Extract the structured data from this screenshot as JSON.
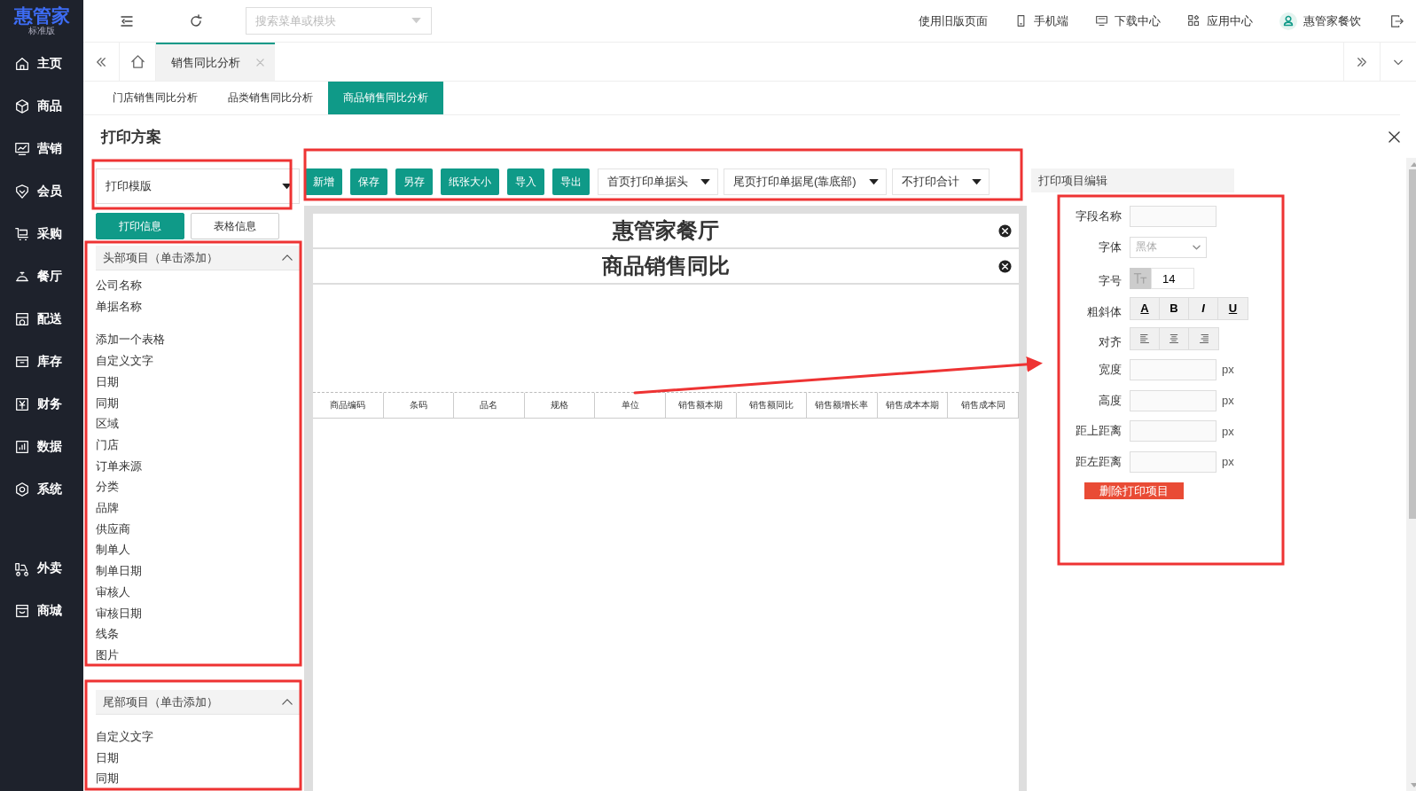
{
  "logo": {
    "title": "惠管家",
    "subtitle": "标准版"
  },
  "sidebar": {
    "groups": [
      [
        {
          "label": "主页",
          "kind": "home"
        },
        {
          "label": "商品",
          "kind": "box"
        },
        {
          "label": "营销",
          "kind": "chart"
        },
        {
          "label": "会员",
          "kind": "shield"
        },
        {
          "label": "采购",
          "kind": "cart"
        },
        {
          "label": "餐厅",
          "kind": "bell"
        },
        {
          "label": "配送",
          "kind": "delivery"
        },
        {
          "label": "库存",
          "kind": "tray"
        },
        {
          "label": "财务",
          "kind": "yen"
        },
        {
          "label": "数据",
          "kind": "bars"
        },
        {
          "label": "系统",
          "kind": "gear"
        }
      ],
      [
        {
          "label": "外卖",
          "kind": "bike"
        },
        {
          "label": "商城",
          "kind": "shop"
        }
      ]
    ]
  },
  "topbar": {
    "search": {
      "placeholder": "搜索菜单或模块"
    },
    "links": [
      {
        "label": "使用旧版页面",
        "kind": "text"
      },
      {
        "label": "手机端",
        "kind": "phone"
      },
      {
        "label": "下载中心",
        "kind": "monitor"
      },
      {
        "label": "应用中心",
        "kind": "apps"
      },
      {
        "label": "惠管家餐饮",
        "kind": "user"
      }
    ]
  },
  "tabs": [
    {
      "label": "销售同比分析",
      "selected": true
    }
  ],
  "subtabs": [
    {
      "label": "门店销售同比分析",
      "selected": false
    },
    {
      "label": "品类销售同比分析",
      "selected": false
    },
    {
      "label": "商品销售同比分析",
      "selected": true
    }
  ],
  "dialog": {
    "title": "打印方案",
    "template_select": "打印模版",
    "info_tabs": [
      {
        "label": "打印信息",
        "selected": true
      },
      {
        "label": "表格信息",
        "selected": false
      }
    ],
    "sections": [
      {
        "title": "头部项目（单击添加）",
        "expanded": true,
        "groups": [
          [
            "公司名称",
            "单据名称"
          ],
          [
            "添加一个表格",
            "自定义文字",
            "日期",
            "同期",
            "区域",
            "门店",
            "订单来源",
            "分类",
            "品牌",
            "供应商",
            "制单人",
            "制单日期",
            "审核人",
            "审核日期",
            "线条",
            "图片"
          ]
        ]
      },
      {
        "title": "尾部项目（单击添加）",
        "expanded": true,
        "groups": [
          [
            "自定义文字",
            "日期",
            "同期"
          ]
        ]
      }
    ],
    "toolbar": {
      "buttons": [
        "新增",
        "保存",
        "另存",
        "纸张大小",
        "导入",
        "导出"
      ],
      "dropdowns": [
        "首页打印单据头",
        "尾页打印单据尾(靠底部)",
        "不打印合计"
      ]
    },
    "canvas": {
      "rows": [
        "惠管家餐厅",
        "商品销售同比"
      ],
      "table_columns": [
        "商品编码",
        "条码",
        "品名",
        "规格",
        "单位",
        "销售额本期",
        "销售额同比",
        "销售额增长率",
        "销售成本本期",
        "销售成本同"
      ]
    },
    "editor": {
      "title": "打印项目编辑",
      "fields": [
        {
          "label": "字段名称",
          "kind": "input"
        },
        {
          "label": "字体",
          "kind": "select",
          "value": "黑体"
        },
        {
          "label": "字号",
          "kind": "size",
          "value": "14"
        },
        {
          "label": "粗斜体",
          "kind": "styles",
          "options": [
            "A",
            "B",
            "I",
            "U"
          ]
        },
        {
          "label": "对齐",
          "kind": "align"
        },
        {
          "label": "宽度",
          "kind": "input",
          "unit": "px"
        },
        {
          "label": "高度",
          "kind": "input",
          "unit": "px"
        },
        {
          "label": "距上距离",
          "kind": "input",
          "unit": "px"
        },
        {
          "label": "距左距离",
          "kind": "input",
          "unit": "px"
        }
      ],
      "delete_button": "删除打印项目"
    }
  }
}
